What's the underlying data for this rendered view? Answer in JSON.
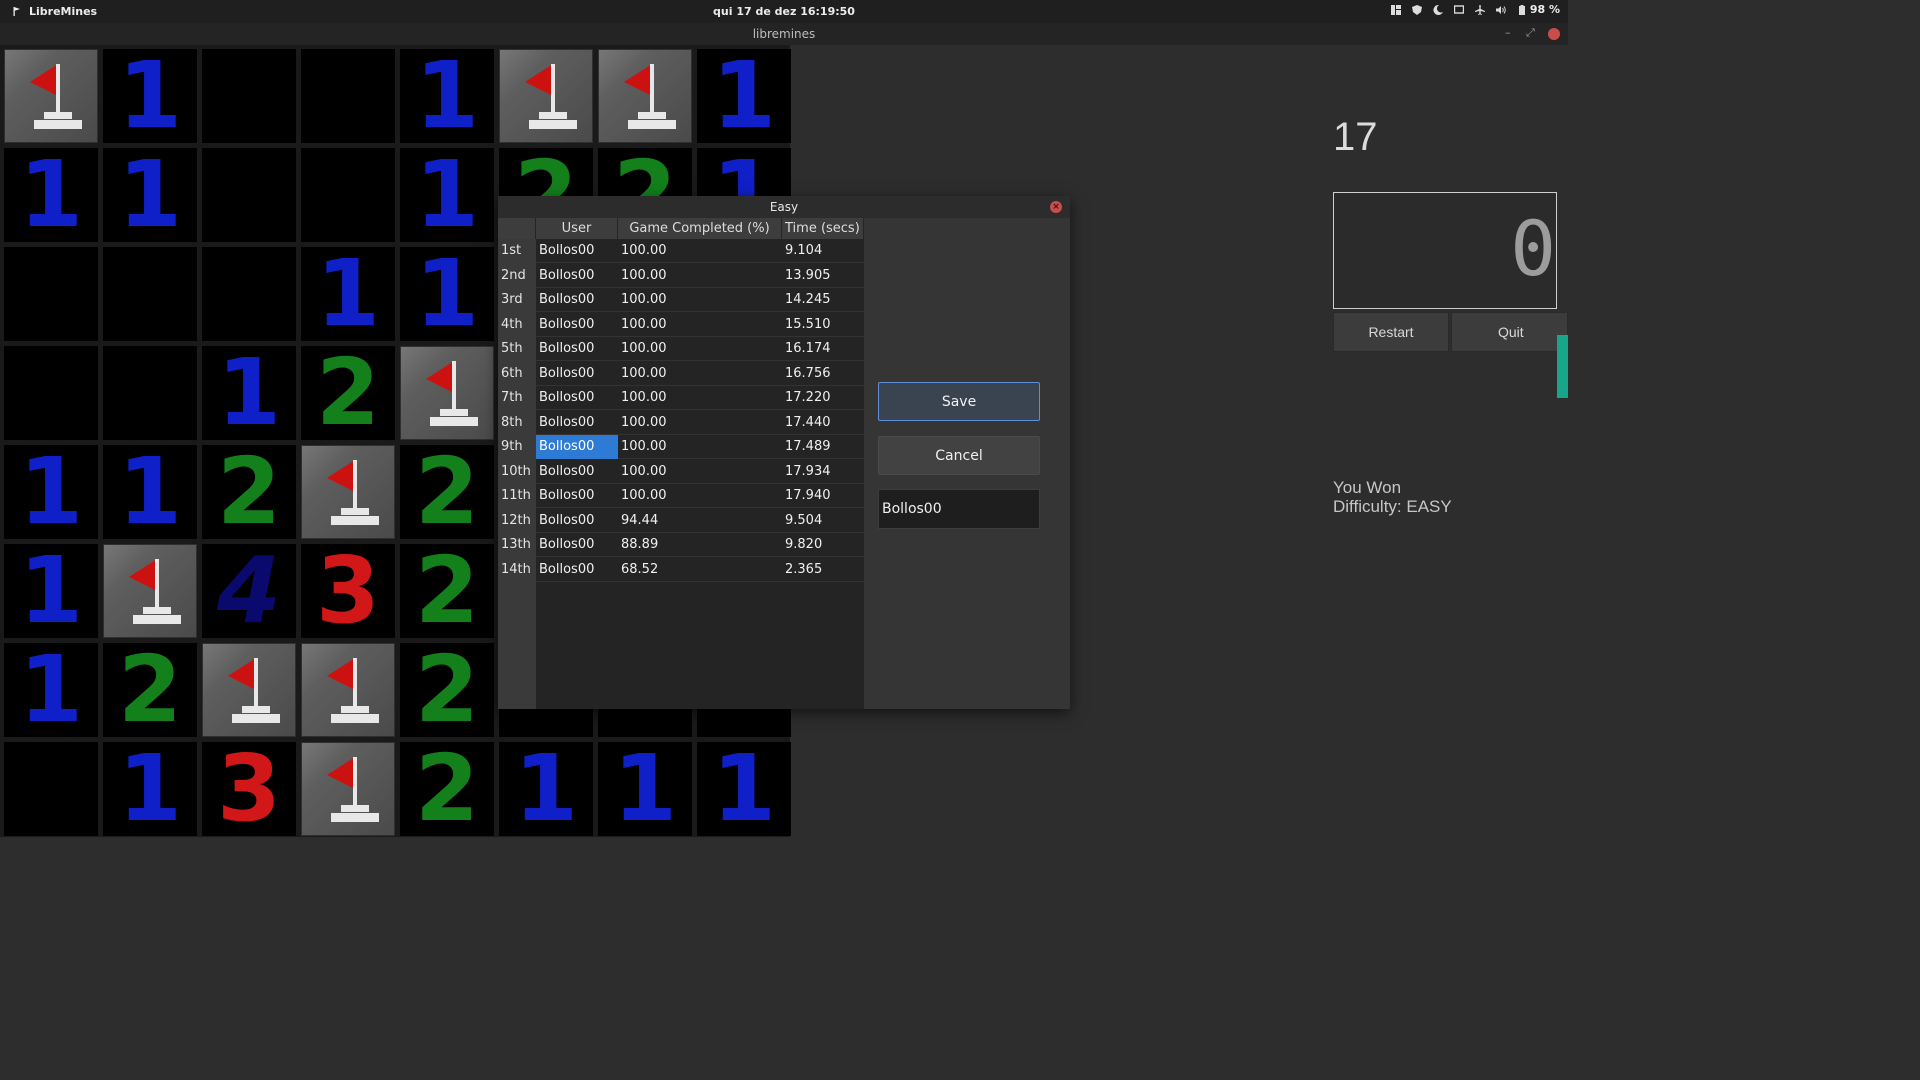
{
  "topbar": {
    "app_name": "LibreMines",
    "clock": "qui 17 de dez  16:19:50",
    "battery": "98 %",
    "icons": [
      "workspace-icon",
      "shield-icon",
      "night-light-icon",
      "display-icon",
      "airplane-icon",
      "volume-icon",
      "battery-icon"
    ]
  },
  "window": {
    "title": "libremines"
  },
  "board": {
    "rows": [
      [
        "F",
        "1",
        "",
        "",
        "1",
        "F",
        "F",
        "1"
      ],
      [
        "1",
        "1",
        "",
        "",
        "1",
        "2",
        "2",
        "1"
      ],
      [
        "",
        "",
        "",
        "1",
        "1",
        "",
        "",
        ""
      ],
      [
        "",
        "",
        "1",
        "2",
        "F",
        "",
        "",
        ""
      ],
      [
        "1",
        "1",
        "2",
        "F",
        "2",
        "",
        "",
        ""
      ],
      [
        "1",
        "F",
        "4",
        "3",
        "2",
        "",
        "",
        ""
      ],
      [
        "1",
        "2",
        "F",
        "F",
        "2",
        "",
        "",
        ""
      ],
      [
        "",
        "1",
        "3",
        "F",
        "2",
        "1",
        "1",
        "1"
      ]
    ]
  },
  "panel": {
    "mines_left": "17",
    "timer": "0",
    "restart": "Restart",
    "quit": "Quit",
    "status_line1": "You Won",
    "status_line2": "Difficulty: EASY"
  },
  "dialog": {
    "title": "Easy",
    "headers": {
      "user": "User",
      "completed": "Game Completed (%)",
      "time": "Time (secs)"
    },
    "rows": [
      {
        "rank": "1st",
        "user": "Bollos00",
        "completed": "100.00",
        "time": "9.104"
      },
      {
        "rank": "2nd",
        "user": "Bollos00",
        "completed": "100.00",
        "time": "13.905"
      },
      {
        "rank": "3rd",
        "user": "Bollos00",
        "completed": "100.00",
        "time": "14.245"
      },
      {
        "rank": "4th",
        "user": "Bollos00",
        "completed": "100.00",
        "time": "15.510"
      },
      {
        "rank": "5th",
        "user": "Bollos00",
        "completed": "100.00",
        "time": "16.174"
      },
      {
        "rank": "6th",
        "user": "Bollos00",
        "completed": "100.00",
        "time": "16.756"
      },
      {
        "rank": "7th",
        "user": "Bollos00",
        "completed": "100.00",
        "time": "17.220"
      },
      {
        "rank": "8th",
        "user": "Bollos00",
        "completed": "100.00",
        "time": "17.440"
      },
      {
        "rank": "9th",
        "user": "Bollos00",
        "completed": "100.00",
        "time": "17.489",
        "selected": true
      },
      {
        "rank": "10th",
        "user": "Bollos00",
        "completed": "100.00",
        "time": "17.934"
      },
      {
        "rank": "11th",
        "user": "Bollos00",
        "completed": "100.00",
        "time": "17.940"
      },
      {
        "rank": "12th",
        "user": "Bollos00",
        "completed": "94.44",
        "time": "9.504"
      },
      {
        "rank": "13th",
        "user": "Bollos00",
        "completed": "88.89",
        "time": "9.820"
      },
      {
        "rank": "14th",
        "user": "Bollos00",
        "completed": "68.52",
        "time": "2.365"
      }
    ],
    "save": "Save",
    "cancel": "Cancel",
    "name_value": "Bollos00"
  },
  "colors": {
    "selection": "#2e7bd6",
    "one": "#1020c8",
    "two": "#13801c",
    "three": "#d11717",
    "four": "#0a0a6e",
    "flag": "#cc1111"
  }
}
